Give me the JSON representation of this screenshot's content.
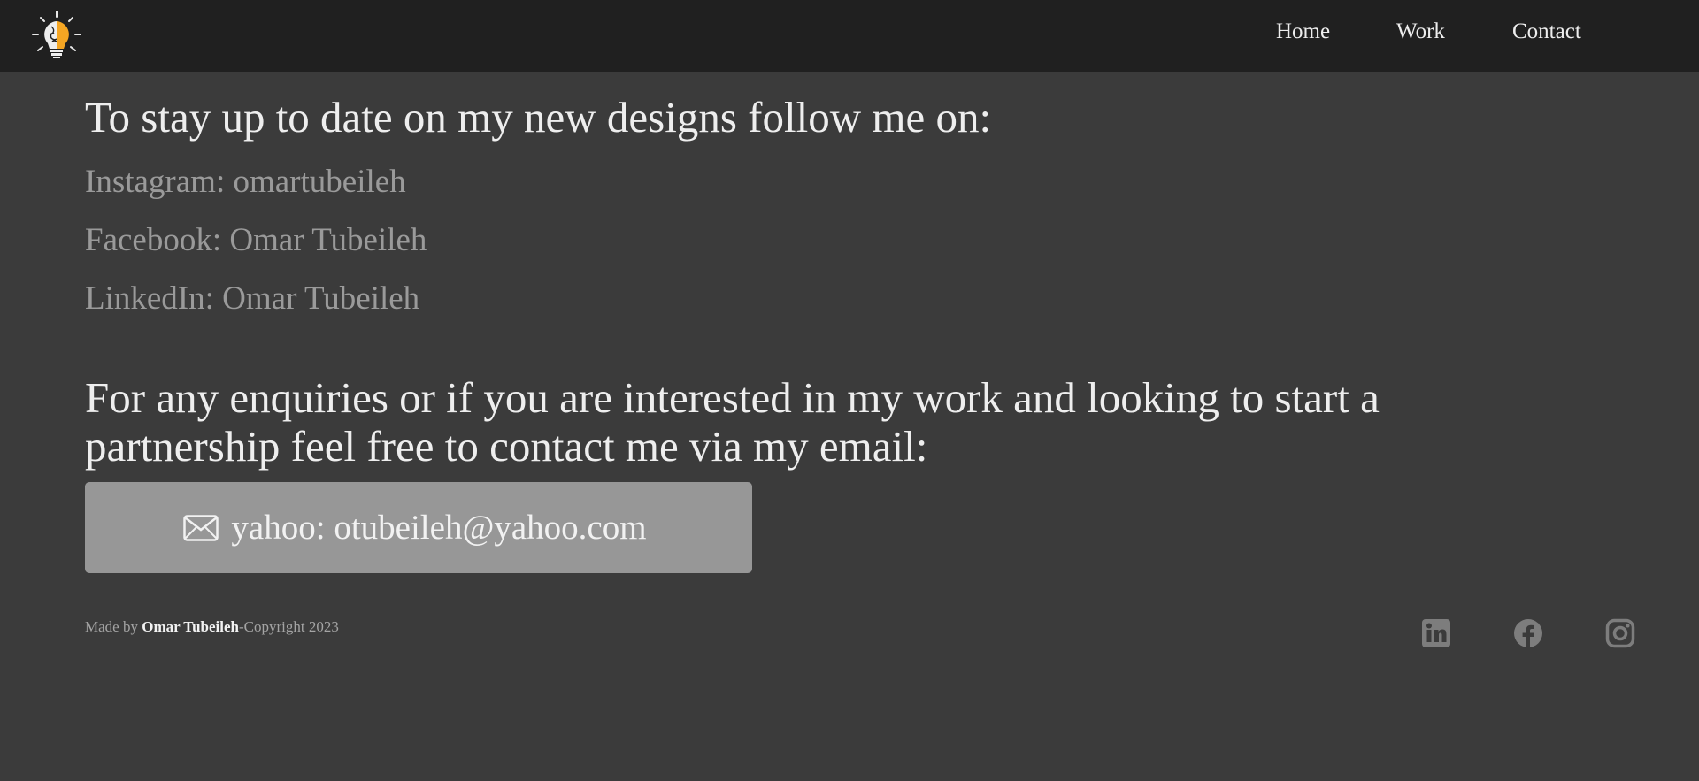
{
  "nav": {
    "logo_icon": "lightbulb-brain-logo",
    "links": [
      {
        "label": "Home"
      },
      {
        "label": "Work"
      },
      {
        "label": "Contact"
      }
    ]
  },
  "main": {
    "follow_heading": "To stay up to date on my new designs follow me on:",
    "socials": [
      {
        "text": "Instagram: omartubeileh"
      },
      {
        "text": "Facebook: Omar Tubeileh"
      },
      {
        "text": "LinkedIn: Omar Tubeileh"
      }
    ],
    "enquiry_heading": "For any enquiries or if you are interested in my work and looking to start a partnership feel free to contact me via my email:",
    "email_button": {
      "icon": "envelope-icon",
      "label": "yahoo: otubeileh@yahoo.com"
    }
  },
  "footer": {
    "made_by_prefix": "Made by ",
    "author": "Omar Tubeileh",
    "copyright": "-Copyright 2023",
    "icons": [
      "linkedin-icon",
      "facebook-icon",
      "instagram-icon"
    ]
  },
  "colors": {
    "background": "#3b3b3b",
    "navbar": "#202020",
    "button": "#979797",
    "muted_text": "#9a9a9a",
    "logo_accent": "#f5a623"
  }
}
